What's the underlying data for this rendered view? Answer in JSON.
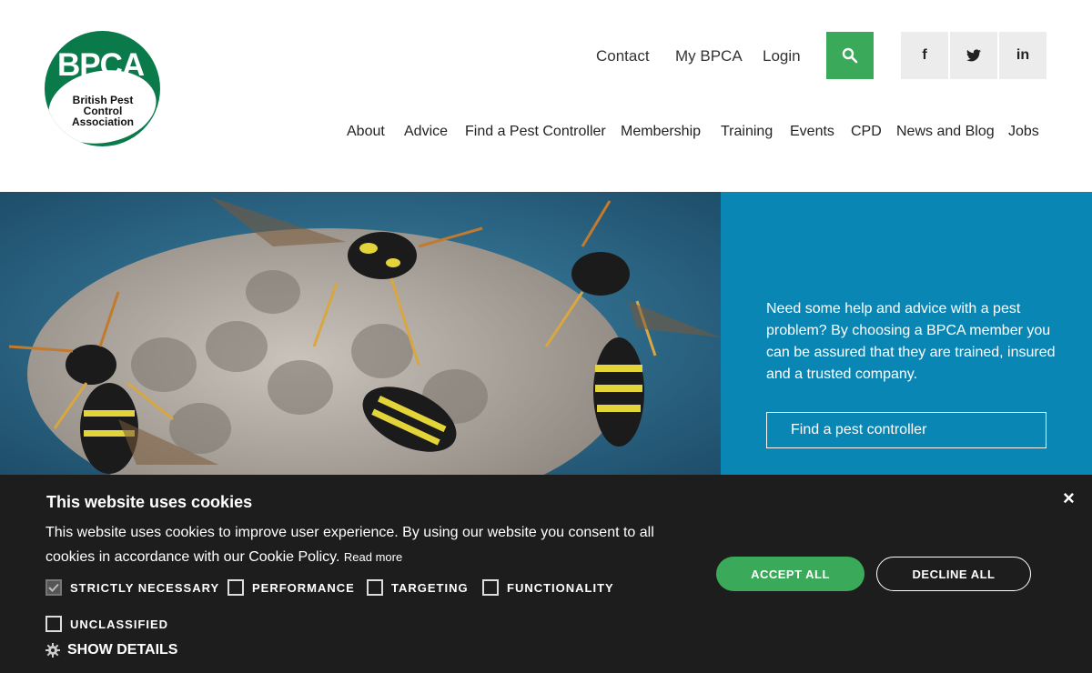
{
  "logo": {
    "main": "BPCA",
    "line1": "British Pest",
    "line2": "Control",
    "line3": "Association"
  },
  "utility_nav": [
    "Contact",
    "My BPCA",
    "Login"
  ],
  "social": {
    "facebook": "f",
    "twitter": "t",
    "linkedin": "in"
  },
  "main_nav": [
    "About",
    "Advice",
    "Find a Pest Controller",
    "Membership",
    "Training",
    "Events",
    "CPD",
    "News and Blog",
    "Jobs"
  ],
  "hero": {
    "text": "Need some help and advice with a pest problem? By choosing a BPCA member you can be assured that they are trained, insured and a trusted company.",
    "button": "Find a pest controller"
  },
  "cookie": {
    "title": "This website uses cookies",
    "description": "This website uses cookies to improve user experience. By using our website you consent to all cookies in accordance with our Cookie Policy.",
    "read_more": "Read more",
    "options": [
      {
        "label": "STRICTLY NECESSARY",
        "checked": true
      },
      {
        "label": "PERFORMANCE",
        "checked": false
      },
      {
        "label": "TARGETING",
        "checked": false
      },
      {
        "label": "FUNCTIONALITY",
        "checked": false
      },
      {
        "label": "UNCLASSIFIED",
        "checked": false
      }
    ],
    "show_details": "SHOW DETAILS",
    "accept": "ACCEPT ALL",
    "decline": "DECLINE ALL",
    "close": "×"
  },
  "colors": {
    "brand_green": "#0b7a4b",
    "accent_green": "#3aaa5a",
    "hero_blue": "#0a86b5",
    "cookie_bg": "#1d1d1d"
  }
}
